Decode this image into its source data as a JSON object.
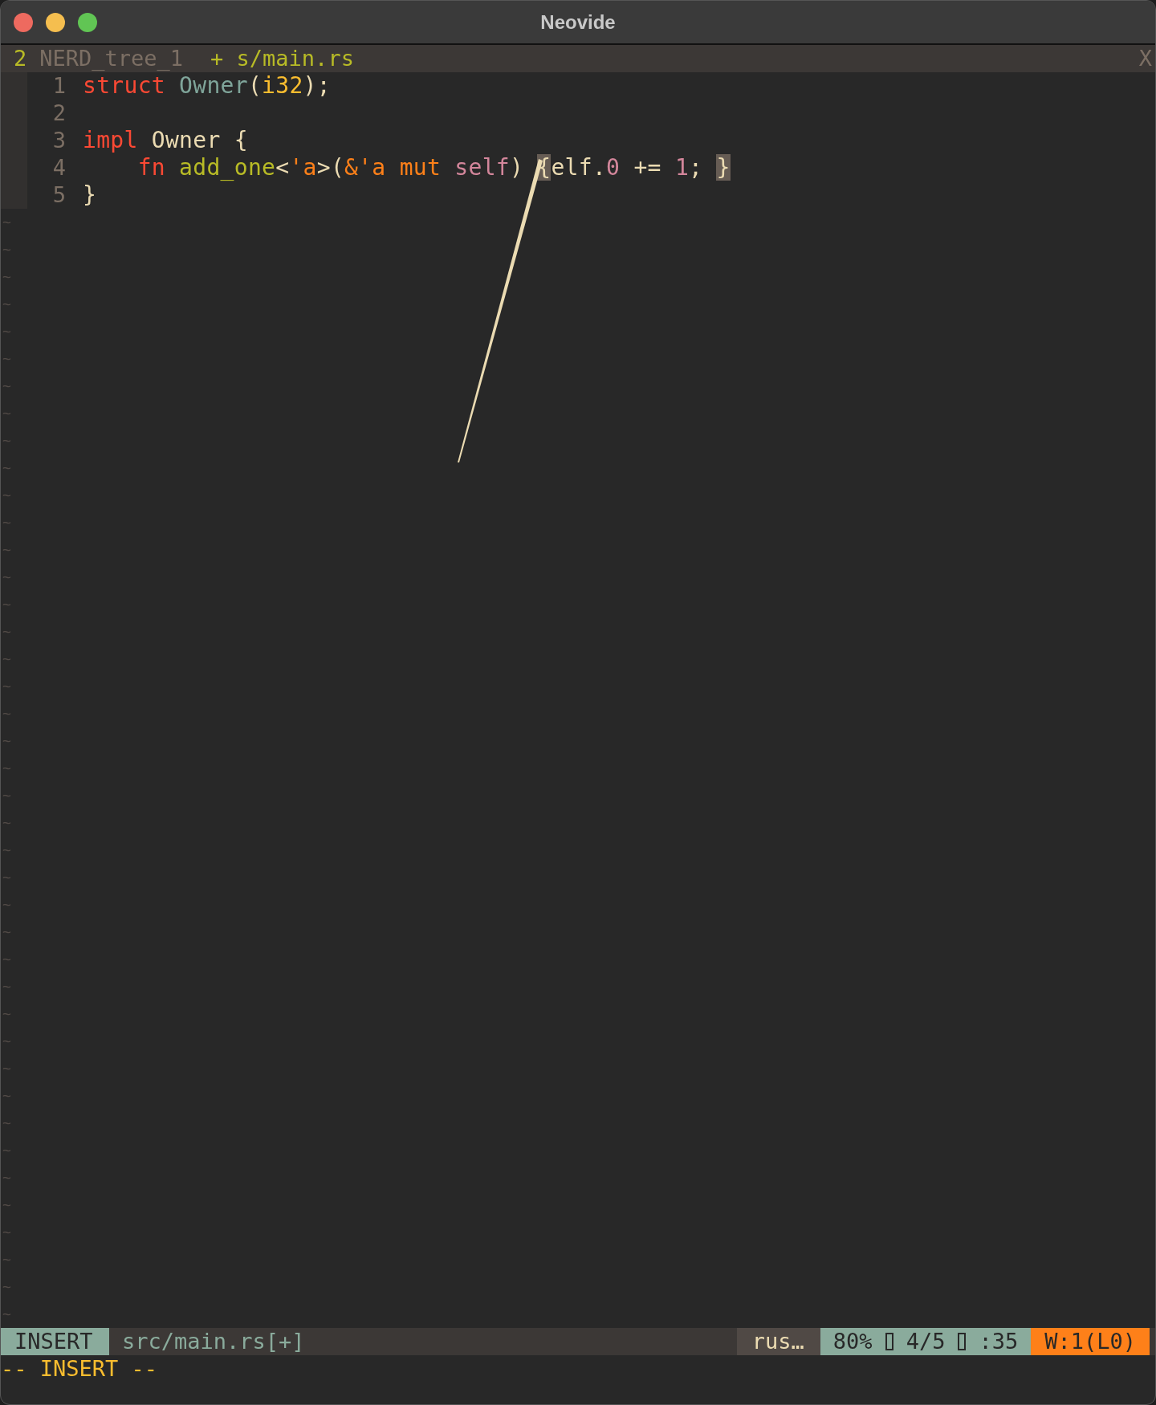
{
  "window": {
    "title": "Neovide"
  },
  "tabline": {
    "count": "2",
    "tabs": [
      {
        "label": "NERD_tree_1",
        "selected": false
      },
      {
        "label": "+ s/main.rs",
        "selected": true
      }
    ],
    "close": "X"
  },
  "lines": [
    {
      "number": "1",
      "tokens": [
        {
          "text": "struct",
          "kind": "keyword"
        },
        {
          "text": " Owner",
          "kind": "type"
        },
        {
          "text": "(",
          "kind": "plain"
        },
        {
          "text": "i32",
          "kind": "builtin"
        },
        {
          "text": ");",
          "kind": "plain"
        }
      ]
    },
    {
      "number": "2"
    },
    {
      "number": "3",
      "tokens": [
        {
          "text": "impl",
          "kind": "keyword"
        },
        {
          "text": " Owner {",
          "kind": "plain"
        }
      ]
    },
    {
      "number": "4",
      "tokens": [
        {
          "text": "    fn",
          "kind": "keyword"
        },
        {
          "text": " add_one",
          "kind": "function"
        },
        {
          "text": "<",
          "kind": "plain"
        },
        {
          "text": "'a",
          "kind": "lifetime"
        },
        {
          "text": ">(",
          "kind": "plain"
        },
        {
          "text": "&'a mut",
          "kind": "lifetime"
        },
        {
          "text": " self",
          "kind": "self"
        },
        {
          "text": ") ",
          "kind": "plain"
        },
        {
          "text": "{",
          "kind": "match"
        },
        {
          "text": "elf.",
          "kind": "plain"
        },
        {
          "text": "0",
          "kind": "number"
        },
        {
          "text": " += ",
          "kind": "plain"
        },
        {
          "text": "1",
          "kind": "number"
        },
        {
          "text": "; ",
          "kind": "plain"
        },
        {
          "text": "}",
          "kind": "match"
        }
      ]
    },
    {
      "number": "5",
      "tokens": [
        {
          "text": "}",
          "kind": "plain"
        }
      ]
    }
  ],
  "tildes": [
    "~",
    "~",
    "~",
    "~",
    "~",
    "~",
    "~",
    "~",
    "~",
    "~",
    "~",
    "~",
    "~",
    "~",
    "~",
    "~",
    "~",
    "~",
    "~",
    "~",
    "~",
    "~",
    "~",
    "~",
    "~",
    "~",
    "~",
    "~",
    "~",
    "~",
    "~",
    "~",
    "~",
    "~",
    "~",
    "~",
    "~",
    "~",
    "~",
    "~",
    "~"
  ],
  "status_bar": {
    "mode": "INSERT",
    "file": "src/main.rs[+]",
    "filetype": "rus…",
    "percent": "80%",
    "line": "4/5",
    "column": ":35",
    "warnings": "W:1(L0)"
  },
  "cmdline": "-- INSERT --"
}
